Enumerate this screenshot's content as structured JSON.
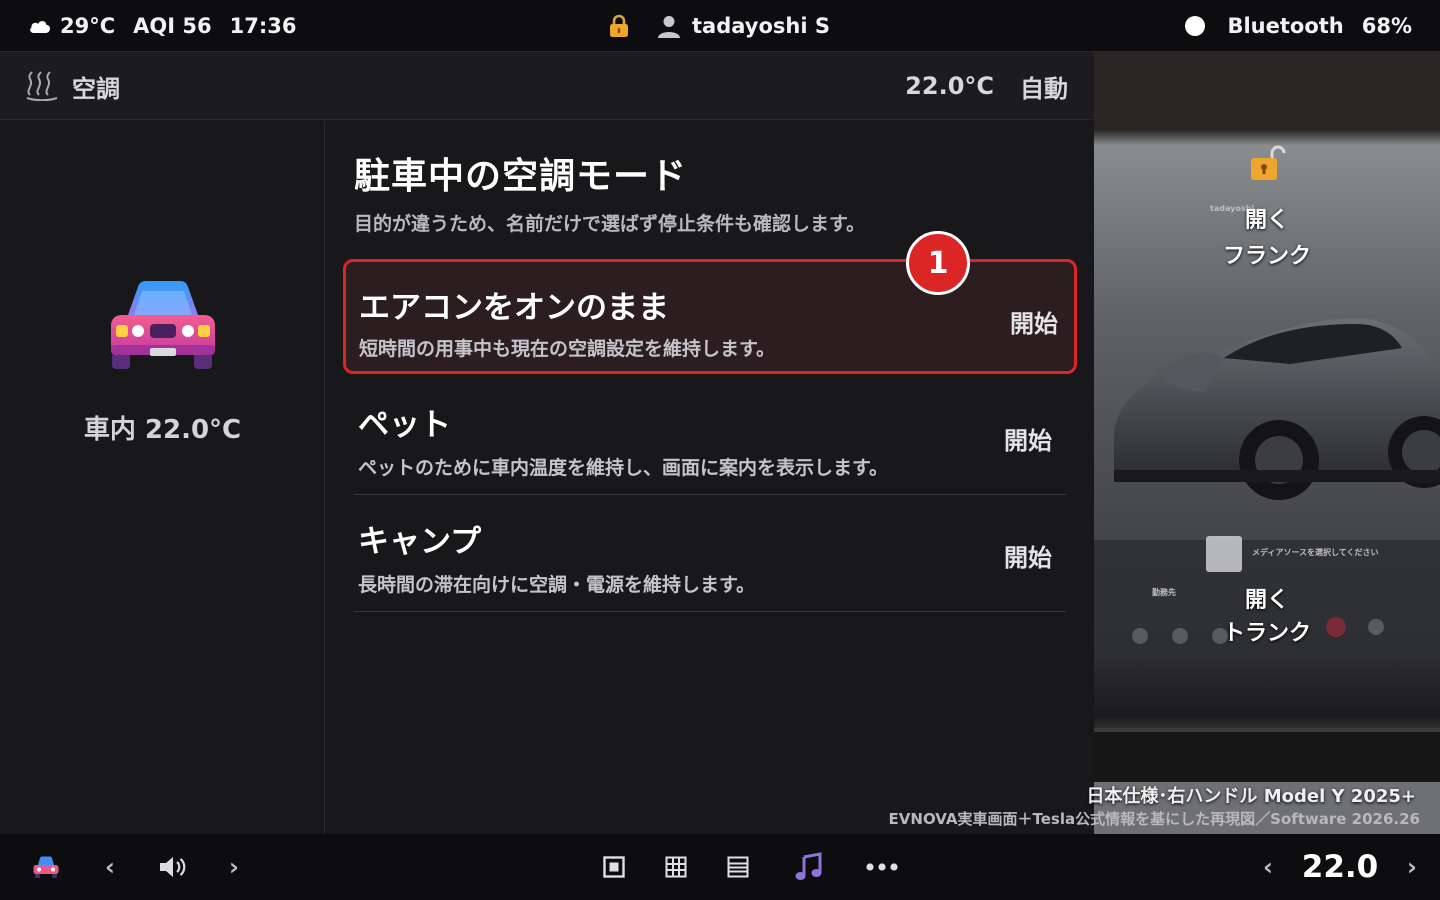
{
  "status_bar": {
    "weather_temp": "29°C",
    "aqi": "AQI 56",
    "time": "17:36",
    "user_name": "tadayoshi S",
    "bluetooth_label": "Bluetooth",
    "battery": "68%"
  },
  "climate_header": {
    "title": "空調",
    "set_temp": "22.0°C",
    "mode": "自動"
  },
  "left_panel": {
    "cabin_temp": "車内 22.0°C"
  },
  "main": {
    "title": "駐車中の空調モード",
    "description": "目的が違うため、名前だけで選ばず停止条件も確認します。",
    "step_badge": "1",
    "modes": [
      {
        "title": "エアコンをオンのまま",
        "description": "短時間の用事中も現在の空調設定を維持します。",
        "action": "開始",
        "selected": true
      },
      {
        "title": "ペット",
        "description": "ペットのために車内温度を維持し、画面に案内を表示します。",
        "action": "開始",
        "selected": false
      },
      {
        "title": "キャンプ",
        "description": "長時間の滞在向けに空調・電源を維持します。",
        "action": "開始",
        "selected": false
      }
    ]
  },
  "photo_panel": {
    "frunk_open": "開く",
    "frunk_label": "フランク",
    "trunk_open": "開く",
    "trunk_label": "トランク",
    "small_user": "tadayoshi",
    "small_frunk": "開く\nトランク",
    "small_media": "メディアソースを選択してください",
    "small_nav": "勤務先",
    "caption": "日本仕様･右ハンドル Model Y 2025+",
    "subcaption": "EVNOVA実車画面＋Tesla公式情報を基にした再現図／Software 2026.26"
  },
  "dock": {
    "temp": "22.0",
    "left_chevron": "‹",
    "right_chevron": "›"
  },
  "colors": {
    "accent_red": "#dc2626",
    "background": "#18181b",
    "bar": "#0d0d0f"
  }
}
